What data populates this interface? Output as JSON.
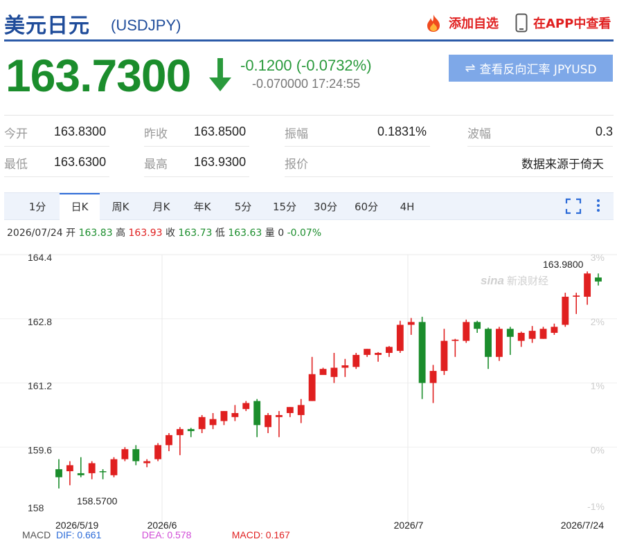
{
  "header": {
    "title": "美元日元",
    "code": "(USDJPY)",
    "add_favorite": "添加自选",
    "open_app": "在APP中查看"
  },
  "quote": {
    "price": "163.7300",
    "change": "-0.1200 (-0.0732%)",
    "sub_change": "-0.070000",
    "time": "17:24:55",
    "direction": "down",
    "reverse_button": "查看反向汇率 JPYUSD"
  },
  "stats": [
    {
      "label": "今开",
      "value": "163.8300"
    },
    {
      "label": "昨收",
      "value": "163.8500"
    },
    {
      "label": "振幅",
      "value": "0.1831%"
    },
    {
      "label": "波幅",
      "value": "0.3"
    },
    {
      "label": "最低",
      "value": "163.6300"
    },
    {
      "label": "最高",
      "value": "163.9300"
    },
    {
      "label": "报价",
      "value": ""
    },
    {
      "label": "",
      "value": "数据来源于倚天"
    }
  ],
  "tabs": [
    "1分",
    "日K",
    "周K",
    "月K",
    "年K",
    "5分",
    "15分",
    "30分",
    "60分",
    "4H"
  ],
  "active_tab": "日K",
  "info_bar": {
    "date": "2026/07/24",
    "open_label": "开",
    "open": "163.83",
    "high_label": "高",
    "high": "163.93",
    "close_label": "收",
    "close": "163.73",
    "low_label": "低",
    "low": "163.63",
    "vol_label": "量",
    "vol": "0",
    "pct": "-0.07%"
  },
  "macd": {
    "label": "MACD",
    "dif": "DIF: 0.661",
    "dea": "DEA: 0.578",
    "macd": "MACD: 0.167"
  },
  "watermark": "新浪财经",
  "colors": {
    "up": "#e02020",
    "down": "#1b8d2c",
    "brand": "#1f4c9a",
    "accent": "#2c6bd8"
  },
  "chart_data": {
    "type": "candlestick",
    "y_ticks": [
      "164.4",
      "162.8",
      "161.2",
      "159.6",
      "158"
    ],
    "y_range": [
      158,
      164.4
    ],
    "right_ticks": [
      "3%",
      "2%",
      "1%",
      "0%",
      "-1%"
    ],
    "x_labels": [
      "2026/5/19",
      "2026/6",
      "2026/7",
      "2026/7/24"
    ],
    "max_label": "163.9800",
    "min_label": "158.5700",
    "candles": [
      {
        "o": 159.05,
        "c": 158.85,
        "h": 159.3,
        "l": 158.57
      },
      {
        "o": 159.0,
        "c": 159.15,
        "h": 159.25,
        "l": 158.65
      },
      {
        "o": 158.95,
        "c": 158.9,
        "h": 159.35,
        "l": 158.85
      },
      {
        "o": 158.95,
        "c": 159.2,
        "h": 159.25,
        "l": 158.8
      },
      {
        "o": 159.0,
        "c": 158.98,
        "h": 159.05,
        "l": 158.8
      },
      {
        "o": 158.9,
        "c": 159.3,
        "h": 159.35,
        "l": 158.85
      },
      {
        "o": 159.3,
        "c": 159.55,
        "h": 159.6,
        "l": 159.25
      },
      {
        "o": 159.55,
        "c": 159.25,
        "h": 159.65,
        "l": 159.15
      },
      {
        "o": 159.2,
        "c": 159.25,
        "h": 159.3,
        "l": 159.1
      },
      {
        "o": 159.3,
        "c": 159.65,
        "h": 159.7,
        "l": 159.25
      },
      {
        "o": 159.65,
        "c": 159.9,
        "h": 159.95,
        "l": 159.5
      },
      {
        "o": 159.9,
        "c": 160.05,
        "h": 160.1,
        "l": 159.4
      },
      {
        "o": 160.05,
        "c": 160.0,
        "h": 160.08,
        "l": 159.85
      },
      {
        "o": 160.05,
        "c": 160.35,
        "h": 160.4,
        "l": 159.95
      },
      {
        "o": 160.15,
        "c": 160.3,
        "h": 160.45,
        "l": 160.05
      },
      {
        "o": 160.25,
        "c": 160.5,
        "h": 160.5,
        "l": 160.15
      },
      {
        "o": 160.35,
        "c": 160.45,
        "h": 160.65,
        "l": 160.25
      },
      {
        "o": 160.55,
        "c": 160.7,
        "h": 160.75,
        "l": 160.5
      },
      {
        "o": 160.75,
        "c": 160.15,
        "h": 160.8,
        "l": 159.85
      },
      {
        "o": 160.1,
        "c": 160.4,
        "h": 160.45,
        "l": 159.95
      },
      {
        "o": 160.35,
        "c": 160.4,
        "h": 160.5,
        "l": 159.85
      },
      {
        "o": 160.45,
        "c": 160.6,
        "h": 160.6,
        "l": 160.35
      },
      {
        "o": 160.4,
        "c": 160.65,
        "h": 160.8,
        "l": 160.2
      },
      {
        "o": 160.75,
        "c": 161.42,
        "h": 161.85,
        "l": 160.75
      },
      {
        "o": 161.4,
        "c": 161.55,
        "h": 161.58,
        "l": 161.42
      },
      {
        "o": 161.35,
        "c": 161.58,
        "h": 161.95,
        "l": 161.2
      },
      {
        "o": 161.58,
        "c": 161.64,
        "h": 161.8,
        "l": 161.35
      },
      {
        "o": 161.6,
        "c": 161.9,
        "h": 161.95,
        "l": 161.55
      },
      {
        "o": 161.9,
        "c": 162.05,
        "h": 162.05,
        "l": 161.85
      },
      {
        "o": 161.9,
        "c": 161.95,
        "h": 161.97,
        "l": 161.73
      },
      {
        "o": 161.95,
        "c": 162.1,
        "h": 162.12,
        "l": 161.85
      },
      {
        "o": 162.0,
        "c": 162.65,
        "h": 162.75,
        "l": 161.95
      },
      {
        "o": 162.65,
        "c": 162.72,
        "h": 162.82,
        "l": 162.4
      },
      {
        "o": 162.72,
        "c": 161.2,
        "h": 162.85,
        "l": 160.8
      },
      {
        "o": 161.2,
        "c": 161.5,
        "h": 161.65,
        "l": 160.7
      },
      {
        "o": 161.5,
        "c": 162.25,
        "h": 162.55,
        "l": 161.4
      },
      {
        "o": 162.25,
        "c": 162.28,
        "h": 162.3,
        "l": 161.85
      },
      {
        "o": 162.25,
        "c": 162.72,
        "h": 162.78,
        "l": 162.2
      },
      {
        "o": 162.72,
        "c": 162.55,
        "h": 162.75,
        "l": 162.45
      },
      {
        "o": 162.55,
        "c": 161.85,
        "h": 162.58,
        "l": 161.55
      },
      {
        "o": 161.85,
        "c": 162.55,
        "h": 162.6,
        "l": 161.75
      },
      {
        "o": 162.55,
        "c": 162.35,
        "h": 162.6,
        "l": 161.9
      },
      {
        "o": 162.25,
        "c": 162.45,
        "h": 162.48,
        "l": 162.1
      },
      {
        "o": 162.3,
        "c": 162.5,
        "h": 162.62,
        "l": 162.2
      },
      {
        "o": 162.3,
        "c": 162.55,
        "h": 162.6,
        "l": 162.3
      },
      {
        "o": 162.45,
        "c": 162.6,
        "h": 162.68,
        "l": 162.4
      },
      {
        "o": 162.65,
        "c": 163.35,
        "h": 163.45,
        "l": 162.6
      },
      {
        "o": 163.35,
        "c": 163.38,
        "h": 163.45,
        "l": 162.92
      },
      {
        "o": 163.35,
        "c": 163.93,
        "h": 163.98,
        "l": 163.15
      },
      {
        "o": 163.83,
        "c": 163.73,
        "h": 163.93,
        "l": 163.63
      }
    ]
  }
}
